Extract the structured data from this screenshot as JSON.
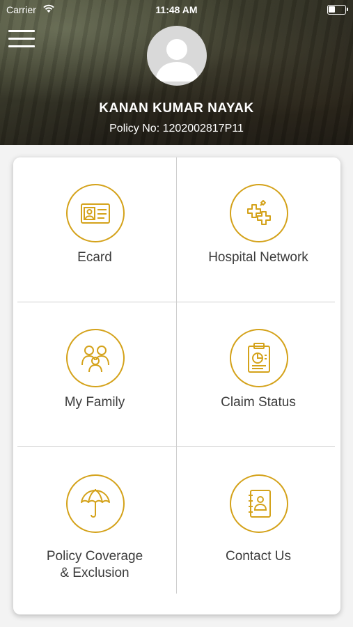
{
  "status_bar": {
    "carrier": "Carrier",
    "time": "11:48 AM",
    "wifi_icon": "wifi-icon",
    "battery_icon": "battery-icon"
  },
  "header": {
    "menu_icon": "hamburger-menu-icon",
    "avatar_icon": "user-avatar-icon",
    "user_name": "KANAN KUMAR NAYAK",
    "policy_no": "Policy No: 1202002817P11"
  },
  "colors": {
    "accent": "#d4a21a",
    "label_text": "#3b3b3b",
    "divider": "#cfcfcf"
  },
  "menu": {
    "items": [
      {
        "label": "Ecard",
        "icon": "id-card-icon"
      },
      {
        "label": "Hospital Network",
        "icon": "hospital-crosses-icon"
      },
      {
        "label": "My Family",
        "icon": "family-icon"
      },
      {
        "label": "Claim Status",
        "icon": "clipboard-chart-icon"
      },
      {
        "label": "Policy Coverage\n& Exclusion",
        "label_line1": "Policy Coverage",
        "label_line2": "& Exclusion",
        "icon": "umbrella-icon"
      },
      {
        "label": "Contact Us",
        "icon": "address-book-icon"
      }
    ]
  }
}
